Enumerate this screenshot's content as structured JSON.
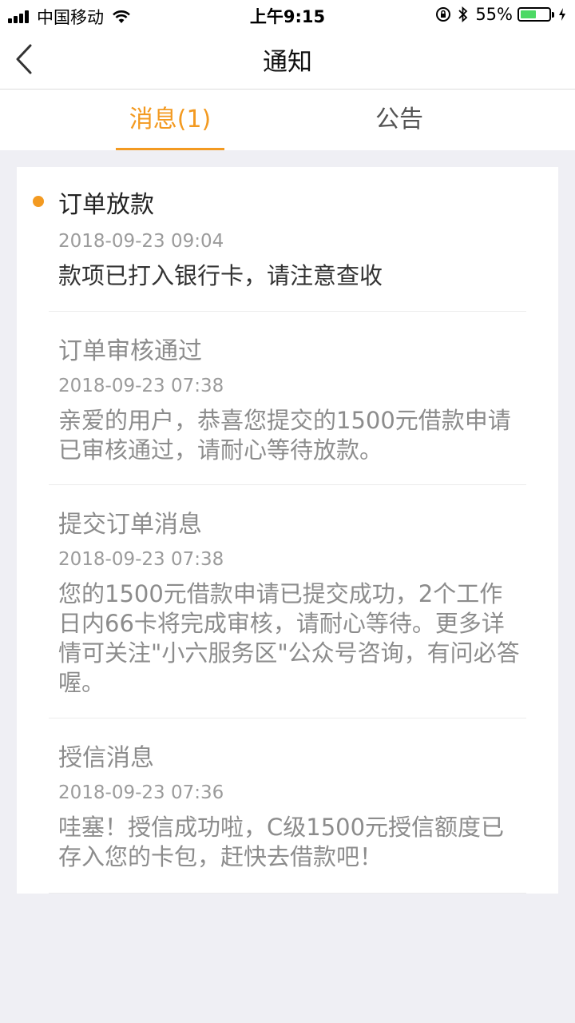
{
  "status_bar": {
    "carrier": "中国移动",
    "time": "上午9:15",
    "battery_percent": "55%",
    "battery_level": 0.55,
    "icons": [
      "signal-icon",
      "wifi-icon",
      "orientation-lock-icon",
      "bluetooth-icon",
      "battery-icon",
      "charging-icon"
    ]
  },
  "nav": {
    "title": "通知",
    "back_icon": "chevron-left-icon"
  },
  "tabs": [
    {
      "label": "消息(1)",
      "active": true
    },
    {
      "label": "公告",
      "active": false
    }
  ],
  "colors": {
    "accent": "#f39a21",
    "background": "#efeff4",
    "read_text": "#8c8c8c"
  },
  "messages": [
    {
      "title": "订单放款",
      "time": "2018-09-23 09:04",
      "body": "款项已打入银行卡，请注意查收",
      "unread": true
    },
    {
      "title": "订单审核通过",
      "time": "2018-09-23 07:38",
      "body": "亲爱的用户，恭喜您提交的1500元借款申请已审核通过，请耐心等待放款。",
      "unread": false
    },
    {
      "title": "提交订单消息",
      "time": "2018-09-23 07:38",
      "body": "您的1500元借款申请已提交成功，2个工作日内66卡将完成审核，请耐心等待。更多详情可关注\"小六服务区\"公众号咨询，有问必答喔。",
      "unread": false
    },
    {
      "title": "授信消息",
      "time": "2018-09-23 07:36",
      "body": "哇塞！授信成功啦，C级1500元授信额度已存入您的卡包，赶快去借款吧！",
      "unread": false
    }
  ]
}
